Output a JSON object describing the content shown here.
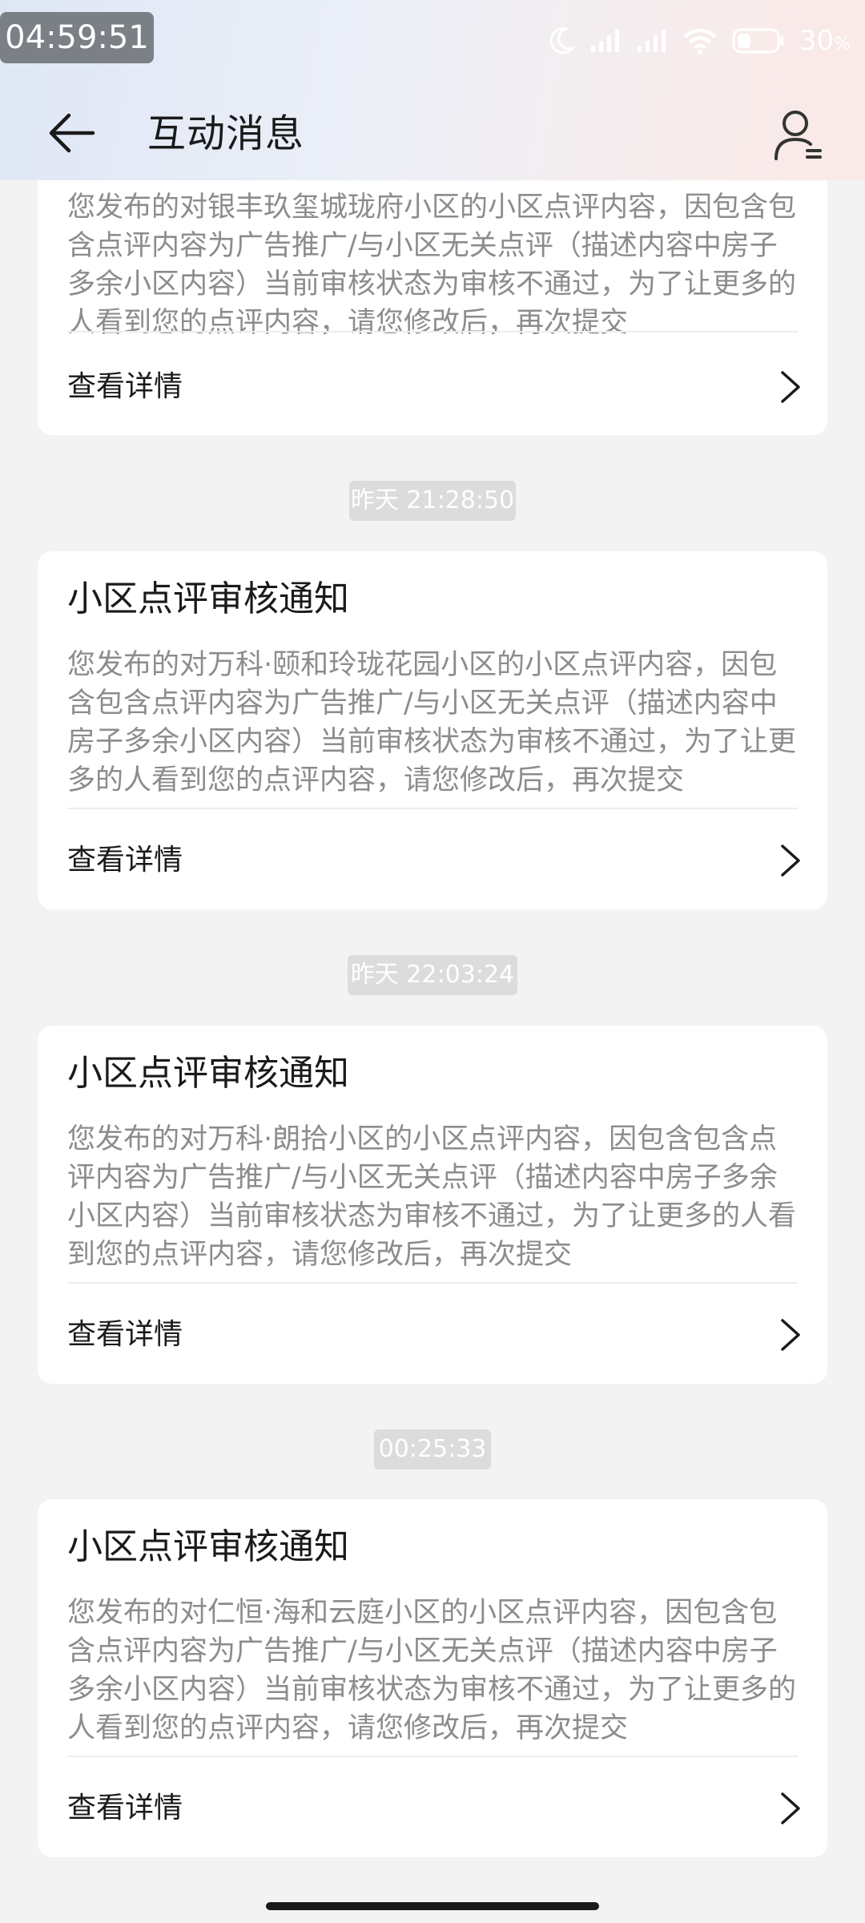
{
  "status_bar": {
    "time": "04:59:51",
    "battery": "30",
    "battery_unit": "%"
  },
  "header": {
    "title": "互动消息"
  },
  "detail_label": "查看详情",
  "messages": [
    {
      "title": "",
      "body": "您发布的对银丰玖玺城珑府小区的小区点评内容，因包含包含点评内容为广告推广/与小区无关点评（描述内容中房子多余小区内容）当前审核状态为审核不通过，为了让更多的人看到您的点评内容，请您修改后，再次提交"
    },
    {
      "time": "昨天 21:28:50",
      "title": "小区点评审核通知",
      "body": "您发布的对万科·颐和玲珑花园小区的小区点评内容，因包含包含点评内容为广告推广/与小区无关点评（描述内容中房子多余小区内容）当前审核状态为审核不通过，为了让更多的人看到您的点评内容，请您修改后，再次提交"
    },
    {
      "time": "昨天 22:03:24",
      "title": "小区点评审核通知",
      "body": "您发布的对万科·朗拾小区的小区点评内容，因包含包含点评内容为广告推广/与小区无关点评（描述内容中房子多余小区内容）当前审核状态为审核不通过，为了让更多的人看到您的点评内容，请您修改后，再次提交"
    },
    {
      "time": "00:25:33",
      "title": "小区点评审核通知",
      "body": "您发布的对仁恒·海和云庭小区的小区点评内容，因包含包含点评内容为广告推广/与小区无关点评（描述内容中房子多余小区内容）当前审核状态为审核不通过，为了让更多的人看到您的点评内容，请您修改后，再次提交"
    }
  ],
  "icons": {
    "back": "back-arrow-icon",
    "profile": "user-profile-icon",
    "chevron": "chevron-right-icon"
  }
}
